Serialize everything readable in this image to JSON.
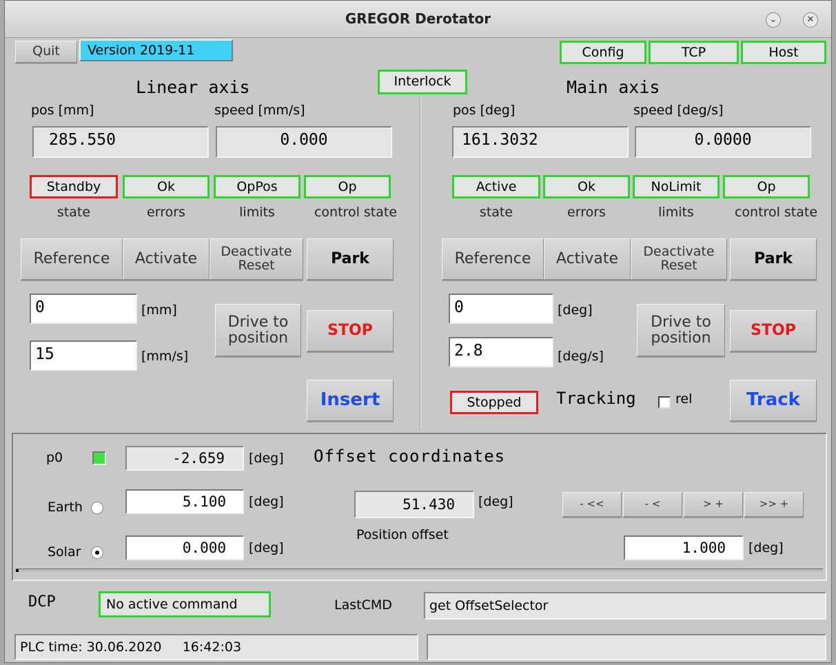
{
  "window": {
    "title": "GREGOR Derotator"
  },
  "topbar": {
    "quit": "Quit",
    "version": "Version 2019-11",
    "config": "Config",
    "tcp": "TCP",
    "host": "Host"
  },
  "interlock": "Interlock",
  "linear": {
    "title": "Linear axis",
    "pos_label": "pos [mm]",
    "speed_label": "speed [mm/s]",
    "pos_value": "285.550",
    "speed_value": "0.000",
    "indicators": [
      "Standby",
      "Ok",
      "OpPos",
      "Op"
    ],
    "indicator_labels": [
      "state",
      "errors",
      "limits",
      "control state"
    ],
    "buttons": {
      "reference": "Reference",
      "activate": "Activate",
      "deactivate_reset": "Deactivate\nReset",
      "park": "Park"
    },
    "target_pos": "0",
    "target_pos_unit": "[mm]",
    "target_speed": "15",
    "target_speed_unit": "[mm/s]",
    "drive": "Drive to\nposition",
    "stop": "STOP",
    "insert": "Insert"
  },
  "main": {
    "title": "Main axis",
    "pos_label": "pos [deg]",
    "speed_label": "speed [deg/s]",
    "pos_value": "161.3032",
    "speed_value": "0.0000",
    "indicators": [
      "Active",
      "Ok",
      "NoLimit",
      "Op"
    ],
    "indicator_labels": [
      "state",
      "errors",
      "limits",
      "control state"
    ],
    "buttons": {
      "reference": "Reference",
      "activate": "Activate",
      "deactivate_reset": "Deactivate\nReset",
      "park": "Park"
    },
    "target_pos": "0",
    "target_pos_unit": "[deg]",
    "target_speed": "2.8",
    "target_speed_unit": "[deg/s]",
    "drive": "Drive to\nposition",
    "stop": "STOP",
    "stopped": "Stopped",
    "tracking": "Tracking",
    "rel": "rel",
    "track": "Track"
  },
  "offset": {
    "title": "Offset coordinates",
    "p0_label": "p0",
    "p0_value": "-2.659",
    "earth_label": "Earth",
    "earth_value": "5.100",
    "solar_label": "Solar",
    "solar_value": "0.000",
    "unit": "[deg]",
    "position_offset_value": "51.430",
    "position_offset_label": "Position offset",
    "step_buttons": [
      "- <<",
      "- <",
      "> +",
      ">> +"
    ],
    "step_value": "1.000",
    "selected_frame": "Solar"
  },
  "dcp": {
    "label": "DCP",
    "status": "No active command",
    "lastcmd_label": "LastCMD",
    "lastcmd_value": "get OffsetSelector"
  },
  "statusbar": {
    "plc_time": "PLC time: 30.06.2020     16:42:03",
    "right": ""
  },
  "colors": {
    "ok_border": "#2fd52f",
    "alert_border": "#e02020",
    "version_bg": "#3fd2f5",
    "blue_text": "#1f4ee3",
    "stop_text": "#e41b1b",
    "led_green": "#3fe33f"
  }
}
